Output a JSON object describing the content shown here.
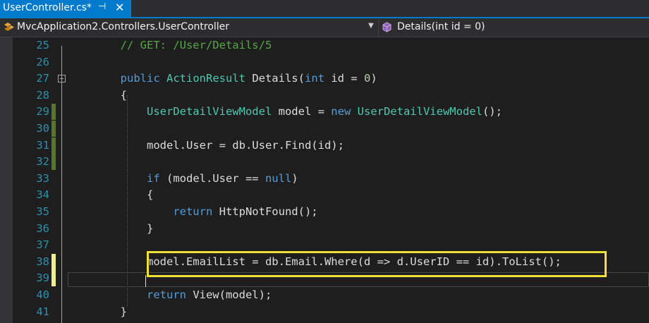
{
  "tab": {
    "title": "UserController.cs*",
    "pin_glyph": "⊣",
    "close_glyph": "✕"
  },
  "nav": {
    "left_label": "MvcApplication2.Controllers.UserController",
    "right_label": "Details(int id = 0)"
  },
  "lines": [
    {
      "n": "25",
      "mark": "none",
      "tokens": [
        {
          "t": "        "
        },
        {
          "c": "cm",
          "t": "// GET: /User/Details/5"
        }
      ]
    },
    {
      "n": "26",
      "mark": "none",
      "tokens": []
    },
    {
      "n": "27",
      "mark": "none",
      "fold": true,
      "tokens": [
        {
          "t": "        "
        },
        {
          "c": "kw",
          "t": "public"
        },
        {
          "t": " "
        },
        {
          "c": "ty",
          "t": "ActionResult"
        },
        {
          "t": " Details("
        },
        {
          "c": "kw",
          "t": "int"
        },
        {
          "t": " id = "
        },
        {
          "c": "nu",
          "t": "0"
        },
        {
          "t": ")"
        }
      ]
    },
    {
      "n": "28",
      "mark": "none",
      "tokens": [
        {
          "t": "        {"
        }
      ]
    },
    {
      "n": "29",
      "mark": "saved",
      "tokens": [
        {
          "t": "            "
        },
        {
          "c": "ty",
          "t": "UserDetailViewModel"
        },
        {
          "t": " model = "
        },
        {
          "c": "kw",
          "t": "new"
        },
        {
          "t": " "
        },
        {
          "c": "ty",
          "t": "UserDetailViewModel"
        },
        {
          "t": "();"
        }
      ]
    },
    {
      "n": "30",
      "mark": "saved",
      "tokens": []
    },
    {
      "n": "31",
      "mark": "saved",
      "tokens": [
        {
          "t": "            model.User = db.User.Find(id);"
        }
      ]
    },
    {
      "n": "32",
      "mark": "saved",
      "tokens": []
    },
    {
      "n": "33",
      "mark": "none",
      "tokens": [
        {
          "t": "            "
        },
        {
          "c": "kw",
          "t": "if"
        },
        {
          "t": " (model.User == "
        },
        {
          "c": "kw",
          "t": "null"
        },
        {
          "t": ")"
        }
      ]
    },
    {
      "n": "34",
      "mark": "none",
      "tokens": [
        {
          "t": "            {"
        }
      ]
    },
    {
      "n": "35",
      "mark": "none",
      "tokens": [
        {
          "t": "                "
        },
        {
          "c": "kw",
          "t": "return"
        },
        {
          "t": " HttpNotFound();"
        }
      ]
    },
    {
      "n": "36",
      "mark": "none",
      "tokens": [
        {
          "t": "            }"
        }
      ]
    },
    {
      "n": "37",
      "mark": "none",
      "tokens": []
    },
    {
      "n": "38",
      "mark": "unsaved",
      "tokens": [
        {
          "t": "            model.EmailList = db.Email.Where(d => d.UserID == id).ToList();"
        }
      ]
    },
    {
      "n": "39",
      "mark": "unsaved",
      "tokens": []
    },
    {
      "n": "40",
      "mark": "none",
      "tokens": [
        {
          "t": "            "
        },
        {
          "c": "kw",
          "t": "return"
        },
        {
          "t": " View(model);"
        }
      ]
    },
    {
      "n": "41",
      "mark": "none",
      "tokens": [
        {
          "t": "        }"
        }
      ]
    }
  ],
  "colors": {
    "accent": "#007acc",
    "saved_mark": "#577430",
    "unsaved_mark": "#efef91",
    "highlight_box": "#f0e03a"
  }
}
